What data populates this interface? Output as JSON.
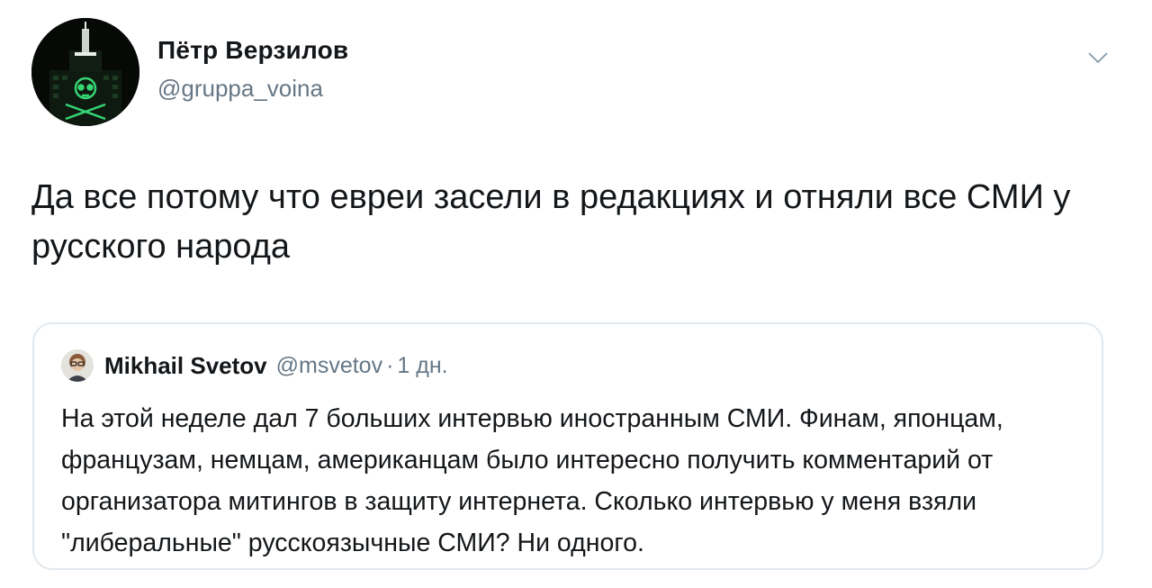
{
  "tweet": {
    "author_name": "Пётр Верзилов",
    "author_handle": "@gruppa_voina",
    "text": "Да все потому что евреи засели в редакциях и отняли все СМИ у русского народа",
    "menu_icon": "chevron-down-icon"
  },
  "quoted_tweet": {
    "author_name": "Mikhail Svetov",
    "author_handle": "@msvetov",
    "separator": "·",
    "time": "1 дн.",
    "text": "На этой неделе дал 7 больших интервью иностранным СМИ. Финам, японцам, французам, немцам, американцам было интересно получить комментарий от организатора митингов в защиту интернета. Сколько интервью у меня взяли \"либеральные\" русскоязычные СМИ? Ни одного."
  },
  "colors": {
    "text_primary": "#14171a",
    "text_secondary": "#657786",
    "border": "#e1e8ed",
    "avatar_glow": "#39e07a"
  }
}
